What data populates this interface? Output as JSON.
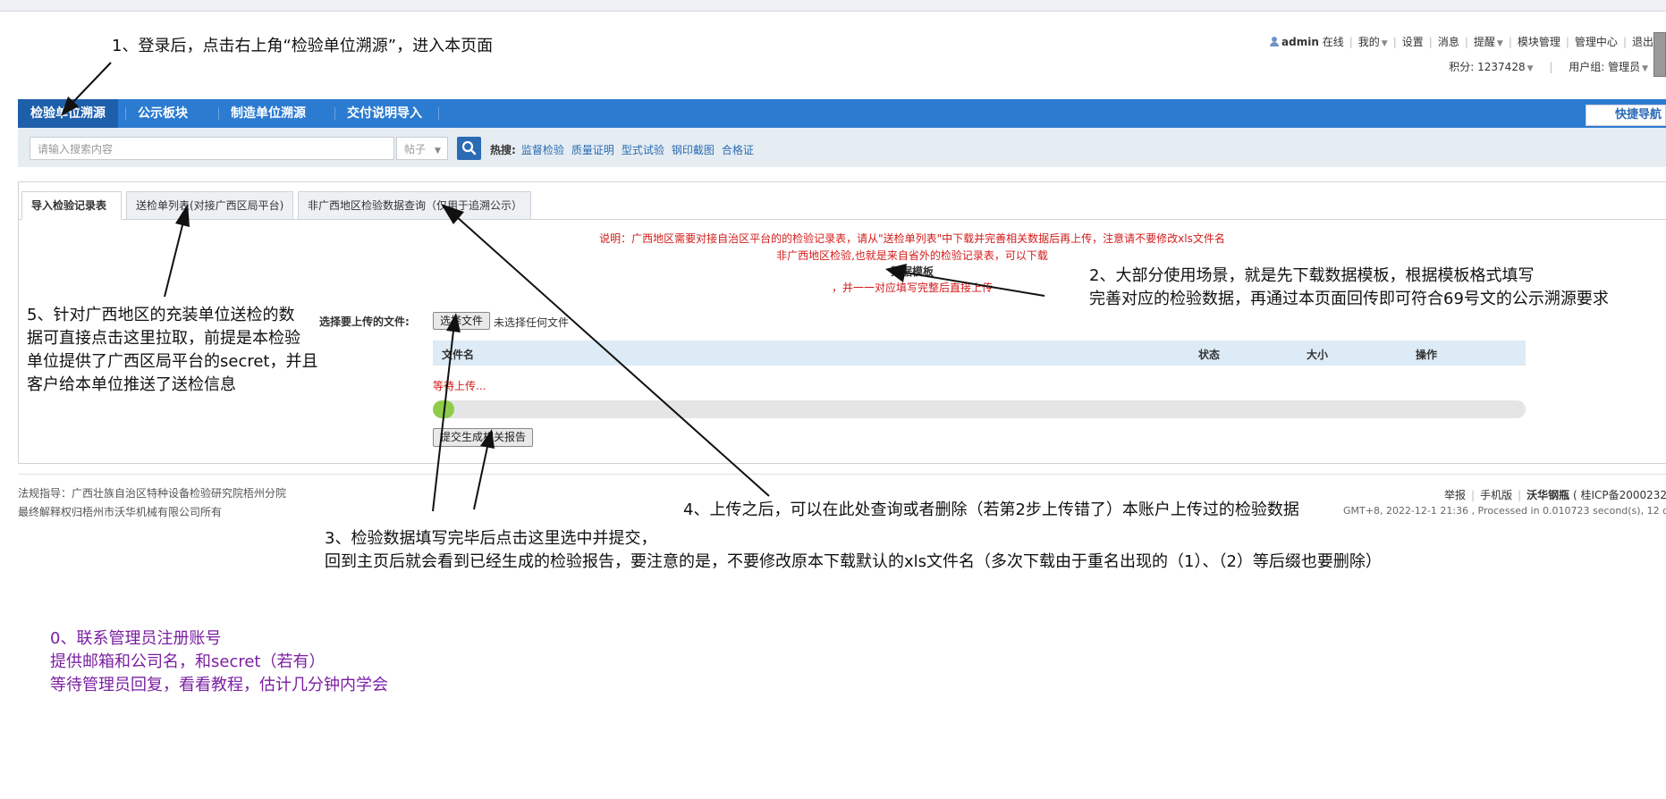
{
  "header": {
    "username": "admin",
    "online": "在线",
    "links": [
      "我的",
      "设置",
      "消息",
      "提醒",
      "模块管理",
      "管理中心",
      "退出"
    ],
    "points_label": "积分: 1237428",
    "group_label": "用户组: 管理员"
  },
  "nav": {
    "items": [
      "检验单位溯源",
      "公示板块",
      "制造单位溯源",
      "交付说明导入"
    ],
    "quick_nav": "快捷导航"
  },
  "search": {
    "placeholder": "请输入搜索内容",
    "type": "帖子",
    "hot_label": "热搜:",
    "hot_links": [
      "监督检验",
      "质量证明",
      "型式试验",
      "钢印截图",
      "合格证"
    ]
  },
  "tabs": [
    "导入检验记录表",
    "送检单列表(对接广西区局平台)",
    "非广西地区检验数据查询（仅用于追溯公示）"
  ],
  "notice": {
    "line1": "说明：广西地区需要对接自治区平台的的检验记录表，请从\"送检单列表\"中下载并完善相关数据后再上传，注意请不要修改xls文件名",
    "line2": "非广西地区检验,也就是来自省外的检验记录表，可以下载",
    "template": "数据模板",
    "line3": "，并一一对应填写完整后直接上传"
  },
  "upload": {
    "label": "选择要上传的文件:",
    "choose_button": "选择文件",
    "no_file": "未选择任何文件",
    "columns": [
      "文件名",
      "状态",
      "大小",
      "操作"
    ],
    "waiting": "等待上传...",
    "progress": 0.02,
    "submit_button": "提交生成相关报告"
  },
  "footer": {
    "left_line1": "法规指导：广西壮族自治区特种设备检验研究院梧州分院",
    "left_line2": "最终解释权归梧州市沃华机械有限公司所有",
    "links": [
      "举报",
      "手机版"
    ],
    "brand": "沃华钢瓶",
    "icp": "( 桂ICP备2000232",
    "info": "GMT+8, 2022-12-1 21:36 , Processed in 0.010723 second(s), 12 qu"
  },
  "annotations": {
    "a1": "1、登录后，点击右上角“检验单位溯源”，进入本页面",
    "a2_line1": "2、大部分使用场景，就是先下载数据模板，根据模板格式填写",
    "a2_line2": "完善对应的检验数据，再通过本页面回传即可符合69号文的公示溯源要求",
    "a3_line1": "3、检验数据填写完毕后点击这里选中并提交，",
    "a3_line2": "回到主页后就会看到已经生成的检验报告，要注意的是，不要修改原本下载默认的xls文件名（多次下载由于重名出现的（1）、（2）等后缀也要删除）",
    "a4": "4、上传之后，可以在此处查询或者删除（若第2步上传错了）本账户上传过的检验数据",
    "a5_line1": "5、针对广西地区的充装单位送检的数",
    "a5_line2": "据可直接点击这里拉取，前提是本检验",
    "a5_line3": "单位提供了广西区局平台的secret，并且",
    "a5_line4": "客户给本单位推送了送检信息",
    "a0_line1": "0、联系管理员注册账号",
    "a0_line2": "提供邮箱和公司名，和secret（若有）",
    "a0_line3": "等待管理员回复，看看教程，估计几分钟内学会"
  },
  "colors": {
    "nav_bg": "#2b7bd1",
    "nav_active": "#1e5fab",
    "notice_red": "#d21b1b",
    "annotation_purple": "#7b1fa2",
    "progress_green": "#8fcc4a"
  }
}
